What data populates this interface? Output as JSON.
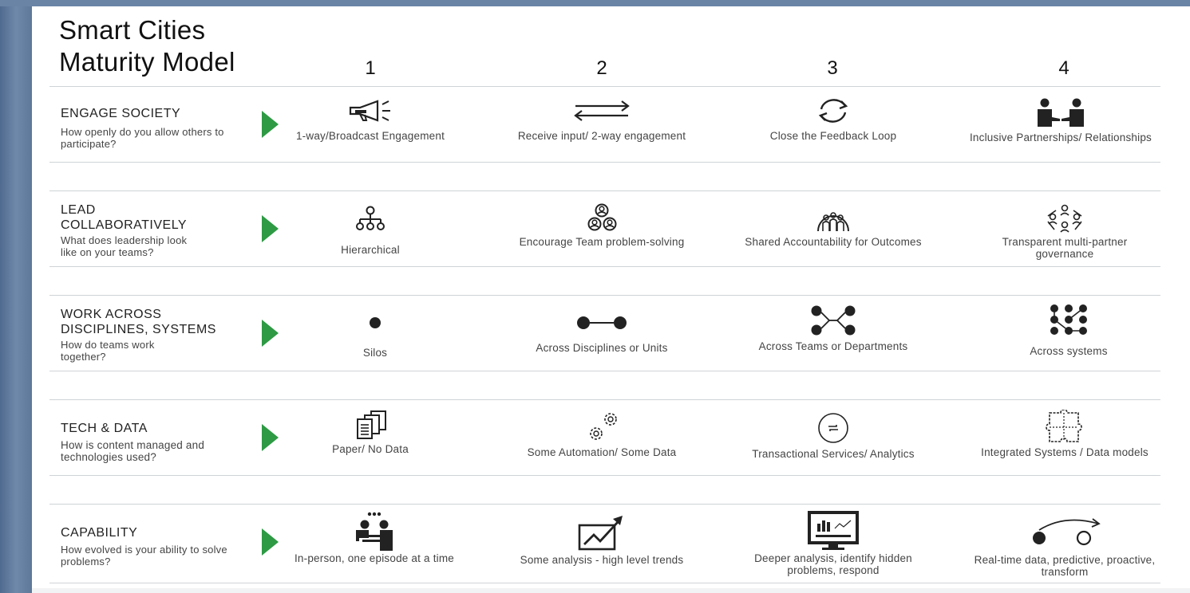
{
  "title_line1": "Smart Cities",
  "title_line2": "Maturity Model",
  "levels": [
    "1",
    "2",
    "3",
    "4"
  ],
  "rows": [
    {
      "title": "ENGAGE SOCIETY",
      "question": "How openly do you allow others to participate?",
      "cells": [
        {
          "label": "1-way/Broadcast Engagement",
          "icon": "megaphone-icon"
        },
        {
          "label": "Receive input/ 2-way engagement",
          "icon": "two-way-arrows-icon"
        },
        {
          "label": "Close the Feedback Loop",
          "icon": "cycle-arrows-icon"
        },
        {
          "label": "Inclusive Partnerships/ Relationships",
          "icon": "handshake-people-icon"
        }
      ]
    },
    {
      "title": "LEAD COLLABORATIVELY",
      "question": "What does leadership look like on your teams?",
      "cells": [
        {
          "label": "Hierarchical",
          "icon": "hierarchy-icon"
        },
        {
          "label": "Encourage Team problem-solving",
          "icon": "team-group-icon"
        },
        {
          "label": "Shared Accountability for Outcomes",
          "icon": "shared-team-icon"
        },
        {
          "label": "Transparent multi-partner governance",
          "icon": "network-people-icon"
        }
      ]
    },
    {
      "title": "WORK ACROSS DISCIPLINES, SYSTEMS",
      "question": "How do teams work together?",
      "cells": [
        {
          "label": "Silos",
          "icon": "single-dot-icon"
        },
        {
          "label": "Across Disciplines or Units",
          "icon": "two-dots-icon"
        },
        {
          "label": "Across Teams or Departments",
          "icon": "four-dots-cross-icon"
        },
        {
          "label": "Across systems",
          "icon": "dot-network-icon"
        }
      ]
    },
    {
      "title": "TECH & DATA",
      "question": "How is content managed and technologies used?",
      "cells": [
        {
          "label": "Paper/ No Data",
          "icon": "documents-icon"
        },
        {
          "label": "Some Automation/ Some Data",
          "icon": "gears-icon"
        },
        {
          "label": "Transactional Services/ Analytics",
          "icon": "circle-transaction-icon"
        },
        {
          "label": "Integrated Systems / Data models",
          "icon": "puzzle-icon"
        }
      ]
    },
    {
      "title": "CAPABILITY",
      "question": "How evolved is your ability to solve problems?",
      "cells": [
        {
          "label": "In-person, one episode at a time",
          "icon": "meeting-people-icon"
        },
        {
          "label": "Some analysis - high level trends",
          "icon": "trend-chart-icon"
        },
        {
          "label": "Deeper analysis, identify hidden problems, respond",
          "icon": "monitor-analytics-icon"
        },
        {
          "label": "Real-time data, predictive, proactive, transform",
          "icon": "dot-arc-arrow-icon"
        }
      ]
    }
  ],
  "colors": {
    "arrow": "#2e9a44",
    "rule": "#cfd3d6",
    "icon": "#222222"
  }
}
